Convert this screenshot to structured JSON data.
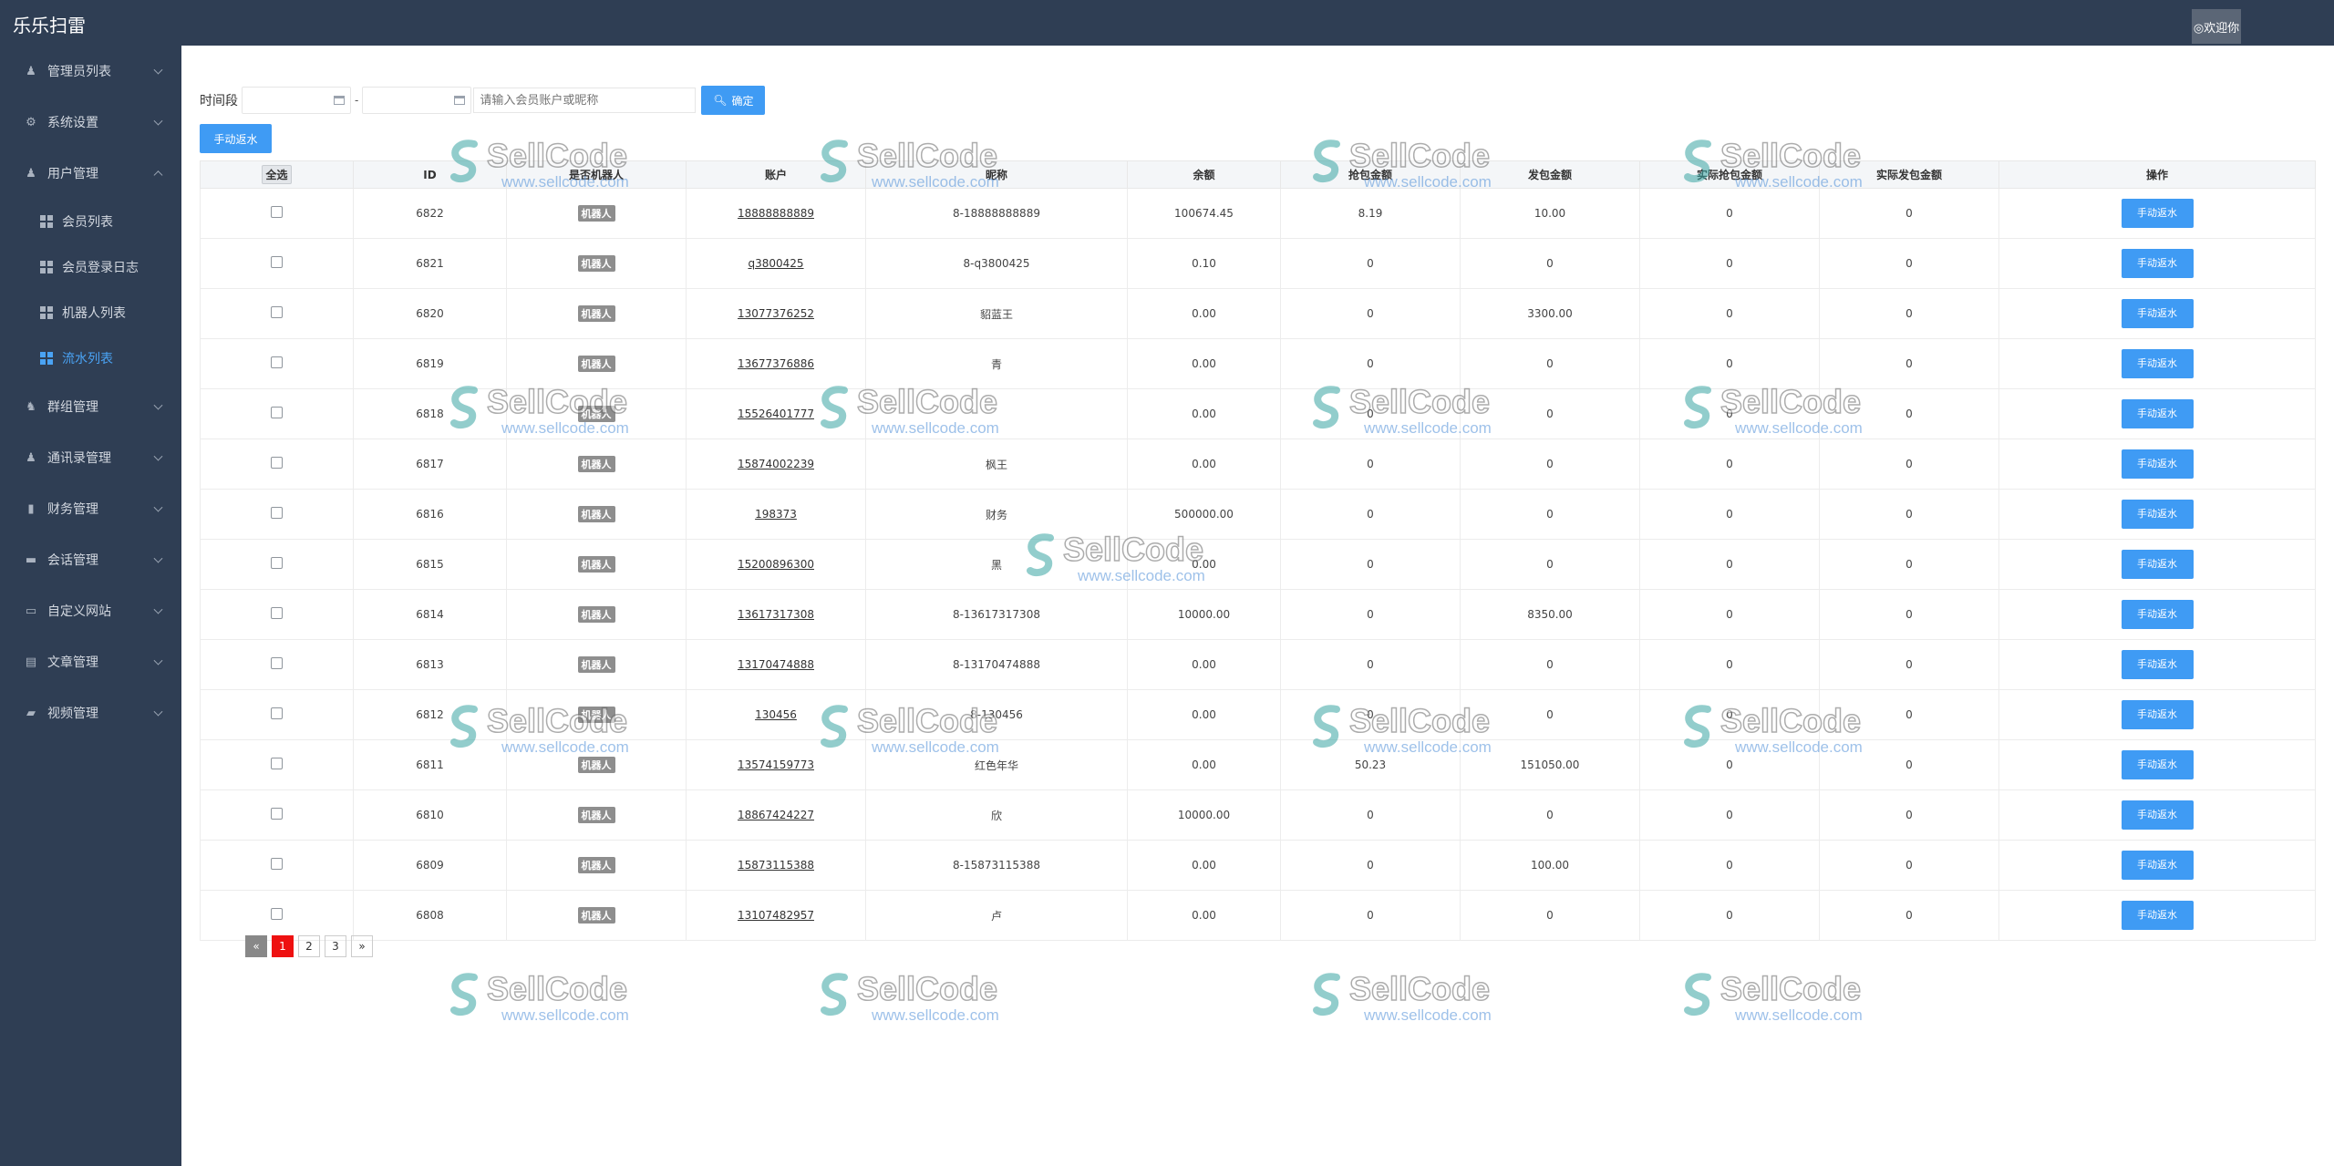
{
  "header": {
    "brand": "乐乐扫雷",
    "welcome": "◎欢迎你"
  },
  "sidebar": {
    "items": [
      {
        "label": "管理员列表",
        "icon": "user-icon",
        "glyph": "♟",
        "expanded": false
      },
      {
        "label": "系统设置",
        "icon": "gear-icon",
        "glyph": "⚙",
        "expanded": false
      },
      {
        "label": "用户管理",
        "icon": "user-icon",
        "glyph": "♟",
        "expanded": true
      },
      {
        "label": "群组管理",
        "icon": "users-icon",
        "glyph": "♞",
        "expanded": false
      },
      {
        "label": "通讯录管理",
        "icon": "user-icon",
        "glyph": "♟",
        "expanded": false
      },
      {
        "label": "财务管理",
        "icon": "bar-chart-icon",
        "glyph": "▮",
        "expanded": false
      },
      {
        "label": "会话管理",
        "icon": "chat-icon",
        "glyph": "▬",
        "expanded": false
      },
      {
        "label": "自定义网站",
        "icon": "monitor-icon",
        "glyph": "▭",
        "expanded": false
      },
      {
        "label": "文章管理",
        "icon": "document-icon",
        "glyph": "▤",
        "expanded": false
      },
      {
        "label": "视频管理",
        "icon": "video-icon",
        "glyph": "▰",
        "expanded": false
      }
    ],
    "sub_items": [
      {
        "label": "会员列表",
        "active": false
      },
      {
        "label": "会员登录日志",
        "active": false
      },
      {
        "label": "机器人列表",
        "active": false
      },
      {
        "label": "流水列表",
        "active": true
      }
    ],
    "active_color": "#4aa3f4"
  },
  "filter": {
    "time_label": "时间段",
    "dash": "-",
    "search_placeholder": "请输入会员账户或昵称",
    "confirm_label": "确定",
    "manual_label": "手动返水"
  },
  "table": {
    "select_all": "全选",
    "columns": [
      "ID",
      "是否机器人",
      "账户",
      "昵称",
      "余额",
      "抢包金额",
      "发包金额",
      "实际抢包金额",
      "实际发包金额",
      "操作"
    ],
    "robot_badge": "机器人",
    "action_label": "手动返水",
    "rows": [
      {
        "id": "6822",
        "account": "18888888889",
        "nickname": "8-18888888889",
        "balance": "100674.45",
        "grab": "8.19",
        "send": "10.00",
        "real_grab": "0",
        "real_send": "0"
      },
      {
        "id": "6821",
        "account": "q3800425",
        "nickname": "8-q3800425",
        "balance": "0.10",
        "grab": "0",
        "send": "0",
        "real_grab": "0",
        "real_send": "0"
      },
      {
        "id": "6820",
        "account": "13077376252",
        "nickname": "貂蓝王",
        "balance": "0.00",
        "grab": "0",
        "send": "3300.00",
        "real_grab": "0",
        "real_send": "0"
      },
      {
        "id": "6819",
        "account": "13677376886",
        "nickname": "青",
        "balance": "0.00",
        "grab": "0",
        "send": "0",
        "real_grab": "0",
        "real_send": "0"
      },
      {
        "id": "6818",
        "account": "15526401777",
        "nickname": "",
        "balance": "0.00",
        "grab": "0",
        "send": "0",
        "real_grab": "0",
        "real_send": "0"
      },
      {
        "id": "6817",
        "account": "15874002239",
        "nickname": "枫王",
        "balance": "0.00",
        "grab": "0",
        "send": "0",
        "real_grab": "0",
        "real_send": "0"
      },
      {
        "id": "6816",
        "account": "198373",
        "nickname": "财务",
        "balance": "500000.00",
        "grab": "0",
        "send": "0",
        "real_grab": "0",
        "real_send": "0"
      },
      {
        "id": "6815",
        "account": "15200896300",
        "nickname": "黑",
        "balance": "0.00",
        "grab": "0",
        "send": "0",
        "real_grab": "0",
        "real_send": "0"
      },
      {
        "id": "6814",
        "account": "13617317308",
        "nickname": "8-13617317308",
        "balance": "10000.00",
        "grab": "0",
        "send": "8350.00",
        "real_grab": "0",
        "real_send": "0"
      },
      {
        "id": "6813",
        "account": "13170474888",
        "nickname": "8-13170474888",
        "balance": "0.00",
        "grab": "0",
        "send": "0",
        "real_grab": "0",
        "real_send": "0"
      },
      {
        "id": "6812",
        "account": "130456",
        "nickname": "8-130456",
        "balance": "0.00",
        "grab": "0",
        "send": "0",
        "real_grab": "0",
        "real_send": "0"
      },
      {
        "id": "6811",
        "account": "13574159773",
        "nickname": "红色年华",
        "balance": "0.00",
        "grab": "50.23",
        "send": "151050.00",
        "real_grab": "0",
        "real_send": "0"
      },
      {
        "id": "6810",
        "account": "18867424227",
        "nickname": "欣",
        "balance": "10000.00",
        "grab": "0",
        "send": "0",
        "real_grab": "0",
        "real_send": "0"
      },
      {
        "id": "6809",
        "account": "15873115388",
        "nickname": "8-15873115388",
        "balance": "0.00",
        "grab": "0",
        "send": "100.00",
        "real_grab": "0",
        "real_send": "0"
      },
      {
        "id": "6808",
        "account": "13107482957",
        "nickname": "卢",
        "balance": "0.00",
        "grab": "0",
        "send": "0",
        "real_grab": "0",
        "real_send": "0"
      }
    ]
  },
  "pagination": {
    "prev": "«",
    "pages": [
      "1",
      "2",
      "3"
    ],
    "current": "1",
    "next": "»"
  },
  "watermark": {
    "brand": "SellCode",
    "url": "www.sellcode.com"
  }
}
